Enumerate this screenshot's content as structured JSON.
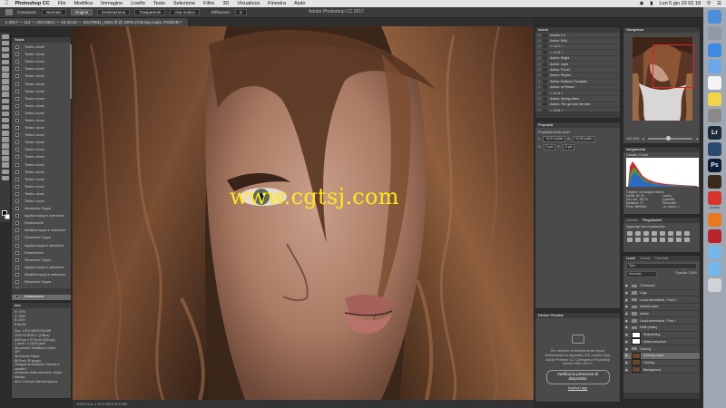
{
  "menubar": {
    "apple": "",
    "app": "Photoshop CC",
    "items": [
      "File",
      "Modifica",
      "Immagine",
      "Livello",
      "Testo",
      "Selezione",
      "Filtro",
      "3D",
      "Visualizza",
      "Finestra",
      "Aiuto"
    ],
    "clock": "Lun 5 giu  20 02 18"
  },
  "options": {
    "campione_label": "Campione:",
    "campione_value": "Normale",
    "origine": "Origine",
    "destinazione": "Destinazione",
    "trasparente": "Trasparente",
    "usa_motivo": "Usa motivo",
    "diffusione_label": "Diffusione:",
    "diffusione_value": "5",
    "window_title": "Adobe Photoshop CC 2017"
  },
  "document": {
    "tabs": [
      "x 2017 — 111 — 20170521 — 23.42.22 — 20170531_0451.tif @ 100% (Cloning copia, RGB/16) *"
    ],
    "status": "100%  Doc: 175,5 MB/378,6 MB"
  },
  "history": {
    "title": "Storia",
    "items": [
      "Timbro clone",
      "Timbro clone",
      "Timbro clone",
      "Timbro clone",
      "Timbro clone",
      "Timbro clone",
      "Timbro clone",
      "Timbro clone",
      "Timbro clone",
      "Timbro clone",
      "Timbro clone",
      "Timbro clone",
      "Timbro clone",
      "Timbro clone",
      "Timbro clone",
      "Timbro clone",
      "Timbro clone",
      "Timbro clone",
      "Timbro clone",
      "Timbro clone",
      "Timbro clone",
      "Timbro clone",
      "Strumento Toppa",
      "Applica toppa e selezione",
      "Deselezione",
      "Modifica toppa e selezione",
      "Strumento Toppa",
      "Applica toppa e selezione",
      "Deselezione",
      "Strumento Toppa",
      "Applica toppa e selezione",
      "Modifica toppa e selezione",
      "Strumento Toppa",
      "Applica toppa e selezione",
      "Deselezione"
    ],
    "selected_index": 34
  },
  "info": {
    "title": "Info",
    "lines": [
      "R:",
      "G:",
      "B:",
      "8 bit"
    ],
    "values": [
      "47%",
      "53%",
      "64%",
      "0%"
    ],
    "text": [
      "Doc: 175,5 MB/378,6 MB",
      "4000 PC/RGB 1 (Ofline)",
      "6000 px x 9776 px (300 ppi)",
      "1 pixel = 1,0000 pixel",
      "Strumento: Modifica e Clone",
      "ZIP",
      "Strumento Toppa",
      "88 Font: 50 gruppi",
      "Disegna la selezione Diversa e sposta il",
      "contenuto della selezione. Usare Maiusc,",
      "Alt e Cmd per ulteriori opzioni."
    ]
  },
  "actions_panel": {
    "tabs": [
      "Azioni"
    ],
    "items": [
      "Insetto 1-3",
      "Action: Mild",
      "< 1.0.2 >",
      "< 1.0.3 >",
      "Action: Bright",
      "Action: Light",
      "Action: Proud",
      "Action: Playful",
      "Action: Endless Thoughts",
      "Action: of Flower",
      "< 1.0.4 >",
      "Action: Spring vibes",
      "Action: The girl and the tree",
      "< 1.0.5 >"
    ]
  },
  "properties": {
    "title": "Proprietà",
    "subtitle": "Proprietà livello pixel",
    "w_label": "L:",
    "w_value": "70,97 pollici",
    "h_label": "A:",
    "h_value": "32,59 pollici",
    "x_label": "X:",
    "x_value": "0 pix",
    "y_label": "Y:",
    "y_value": "0 pix"
  },
  "device_preview": {
    "title": "Device Preview",
    "text": "Per ottenere un'anteprima dei layout direttamente su dispositivi iOS, scarica l'app Adobe Preview CC. Collegare a Photoshop tramite USB o Wi-Fi.",
    "button": "Verifica la presenza di dispositivi",
    "link": "Scarica l'app"
  },
  "navigator": {
    "title": "Navigatore",
    "zoom": "100,10%"
  },
  "histogram": {
    "title": "Istogramma",
    "channel_label": "Canale:",
    "channel_value": "Colori",
    "origin_label": "Origine:",
    "origin_value": "Immagine intera",
    "stats": [
      "Media: 80,33",
      "Livello:",
      "Dev. std.: 58,73",
      "Quantità:",
      "Mediana: 71",
      "Percentile:",
      "Pixel: 3899440",
      "Liv. cache: 1"
    ]
  },
  "adjustments": {
    "tabs": [
      "Librerie",
      "Regolazioni"
    ],
    "active_tab": "Regolazioni",
    "text": "Aggiungi una regolazione"
  },
  "layers": {
    "tabs": [
      "Livelli",
      "Canali",
      "Tracciati"
    ],
    "filter": "Tipo",
    "blend": "Normale",
    "opacity": "Opacità: 100%",
    "items": [
      {
        "name": "Correzioni",
        "type": "folder"
      },
      {
        "name": "Logo",
        "type": "folder"
      },
      {
        "name": "Local corrections - Part 2",
        "type": "folder"
      },
      {
        "name": "Actions pack",
        "type": "folder"
      },
      {
        "name": "Action",
        "type": "folder"
      },
      {
        "name": "Local corrections - Part 1",
        "type": "folder"
      },
      {
        "name": "D&B (basic)",
        "type": "folder"
      },
      {
        "name": "Sharpening",
        "type": "mask"
      },
      {
        "name": "Noise reduction",
        "type": "mask"
      },
      {
        "name": "Cloning",
        "type": "folder"
      },
      {
        "name": "Cloning copia",
        "type": "photo"
      },
      {
        "name": "Cloning",
        "type": "photo"
      },
      {
        "name": "Background",
        "type": "photo"
      }
    ],
    "selected_index": 10
  },
  "dock": {
    "items": [
      "finder",
      "launchpad",
      "safari",
      "mail",
      "calendar",
      "notes",
      "preferences",
      "lightroom",
      "camera-raw",
      "photoshop",
      "bridge",
      "adobe-apps",
      "firefox",
      "filezilla",
      "folder",
      "downloads",
      "trash"
    ],
    "adobe_label": "Adobe"
  },
  "watermark": {
    "text": "www.cgtsj.com"
  },
  "colors": {
    "accent": "#e02222",
    "watermark": "#ffe81a",
    "panel": "#4a4a4a"
  }
}
